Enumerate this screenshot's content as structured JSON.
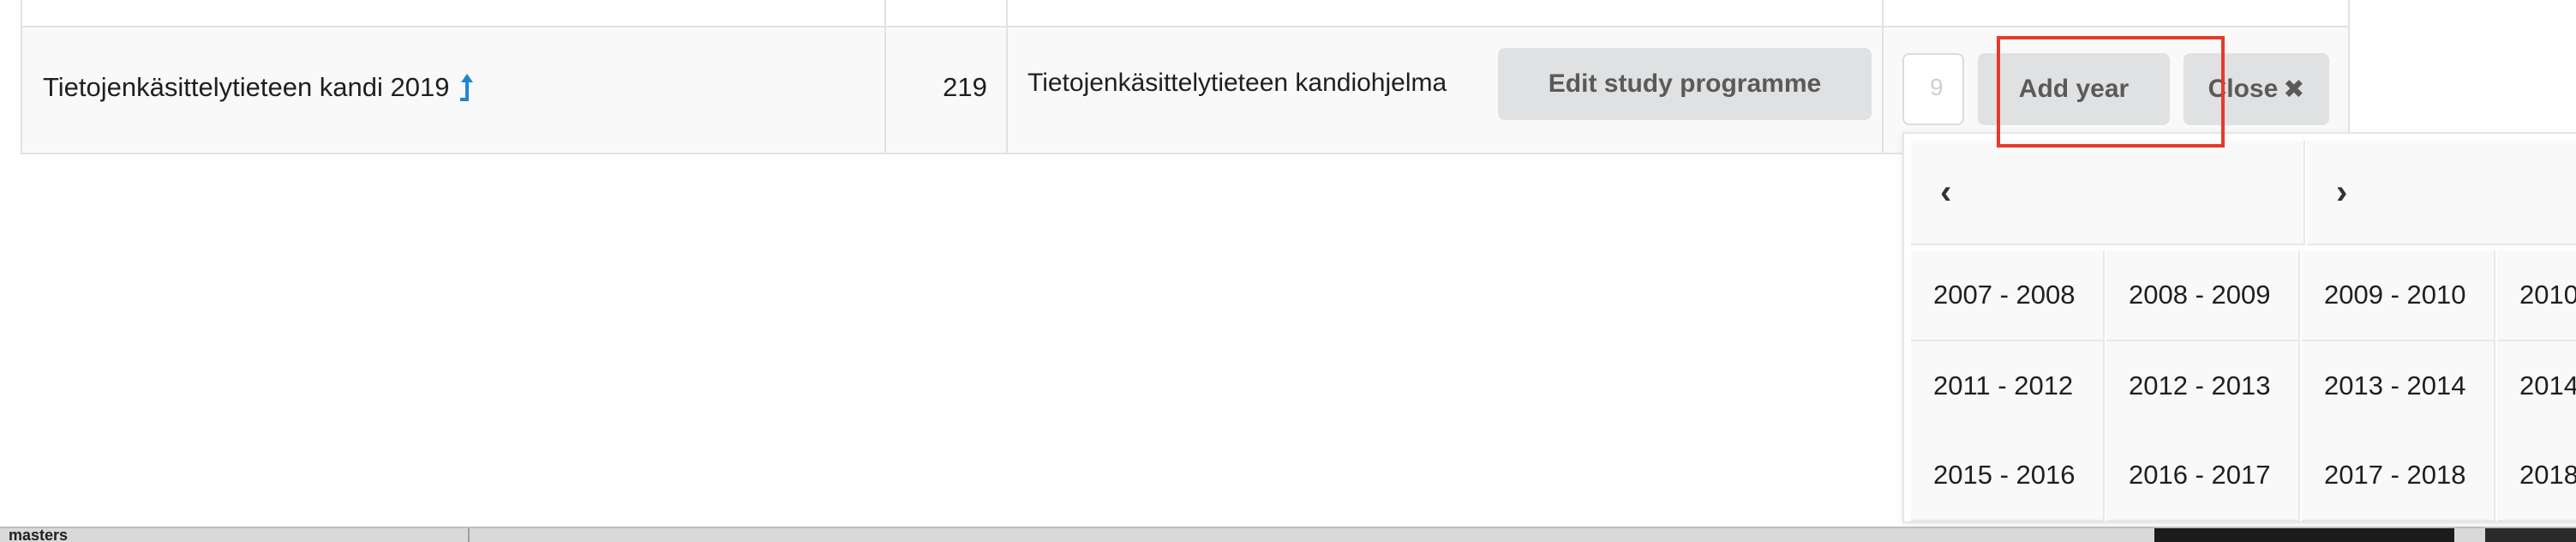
{
  "table": {
    "row": {
      "name": "Tietojenkäsittelytieteen kandi 2019",
      "name_icon": "arrow-up-icon",
      "count": "219",
      "programme": "Tietojenkäsittelytieteen kandiohjelma"
    },
    "edit_label": "Edit study programme",
    "year_input_value": "9",
    "add_year_label": "Add year",
    "close_label": "Close",
    "close_icon": "✖"
  },
  "picker": {
    "prev": "‹",
    "next": "›",
    "years": [
      "2007 - 2008",
      "2008 - 2009",
      "2009 - 2010",
      "2010",
      "2011 - 2012",
      "2012 - 2013",
      "2013 - 2014",
      "2014",
      "2015 - 2016",
      "2016 - 2017",
      "2017 - 2018",
      "2018"
    ]
  },
  "taskbar": {
    "label": "masters"
  },
  "colors": {
    "accent": "#2185d0",
    "highlight": "#e8392a",
    "button": "#e0e1e2"
  }
}
